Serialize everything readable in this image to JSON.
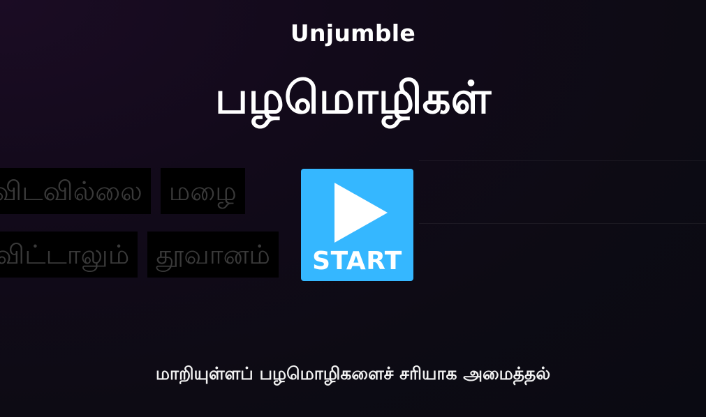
{
  "activity": {
    "type_label": "Unjumble",
    "title": "பழமொழிகள்",
    "description": "மாறியுள்ளப் பழமொழிகளைச் சரியாக அமைத்தல்"
  },
  "preview": {
    "row1": [
      "விடவில்லை",
      "மழை"
    ],
    "row2": [
      "விட்டாலும்",
      "தூவானம்"
    ]
  },
  "start_button": {
    "label": "START",
    "icon": "play-icon",
    "color": "#35b7ff"
  },
  "colors": {
    "background": "#0d0b14",
    "tile_background": "#000000",
    "tile_text": "#3a3a3a",
    "text": "#ffffff"
  }
}
